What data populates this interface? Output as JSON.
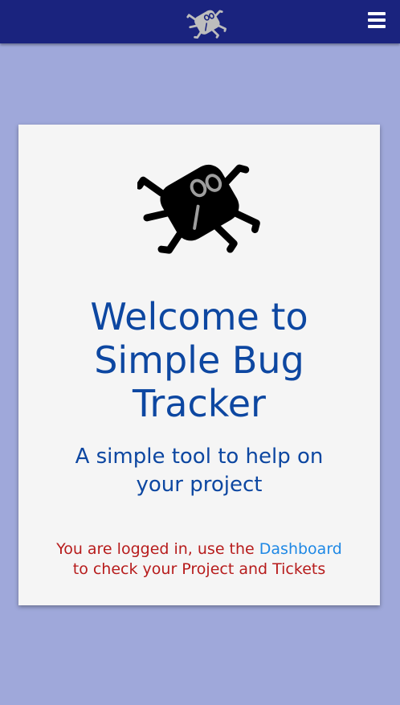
{
  "navbar": {
    "logo_icon": "bug-icon",
    "menu_icon": "hamburger-menu-icon",
    "background": "#1a237e"
  },
  "page": {
    "background": "#9fa8da"
  },
  "card": {
    "logo_icon": "bug-icon",
    "title_line1": "Welcome to",
    "title_line2": "Simple Bug",
    "title_line3": "Tracker",
    "subtitle_line1": "A simple tool to help on",
    "subtitle_line2": "your project",
    "status_prefix": "You are logged in, use the ",
    "dashboard_link": "Dashboard",
    "status_suffix": "to check your Project and Tickets",
    "title_color": "#0d47a1",
    "status_color": "#b71c1c",
    "link_color": "#1e88e5"
  }
}
